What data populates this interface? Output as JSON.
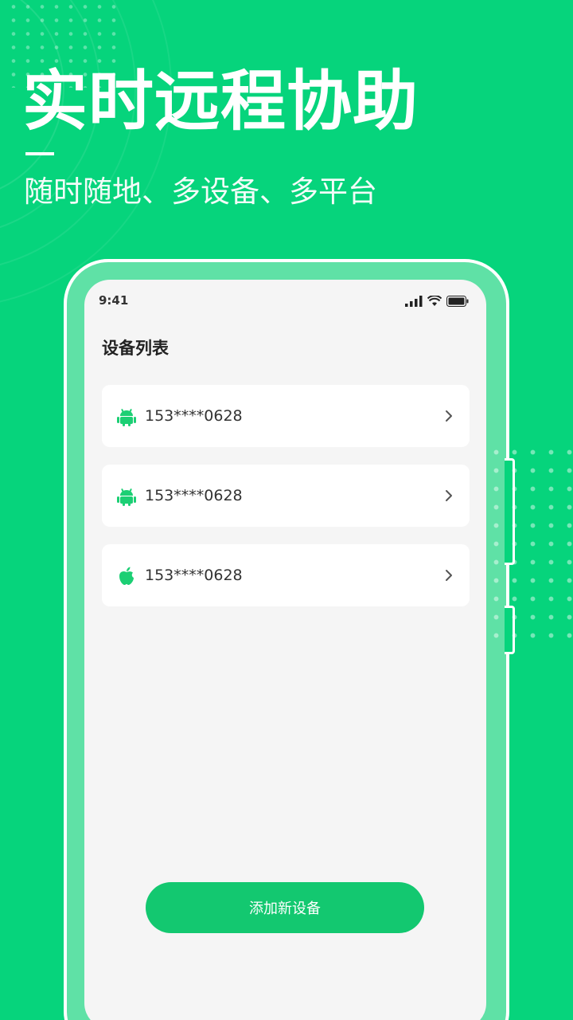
{
  "colors": {
    "background": "#06d47c",
    "frame": "#5fe1a6",
    "screen": "#f5f5f5",
    "accent": "#13c870"
  },
  "hero": {
    "headline": "实时远程协助",
    "subline": "随时随地、多设备、多平台"
  },
  "phone": {
    "status_time": "9:41",
    "status_icons": [
      "signal-icon",
      "wifi-icon",
      "battery-icon"
    ],
    "title": "设备列表",
    "devices": [
      {
        "icon": "android-icon",
        "number": "153****0628"
      },
      {
        "icon": "android-icon",
        "number": "153****0628"
      },
      {
        "icon": "apple-icon",
        "number": "153****0628"
      }
    ],
    "add_button_label": "添加新设备"
  }
}
